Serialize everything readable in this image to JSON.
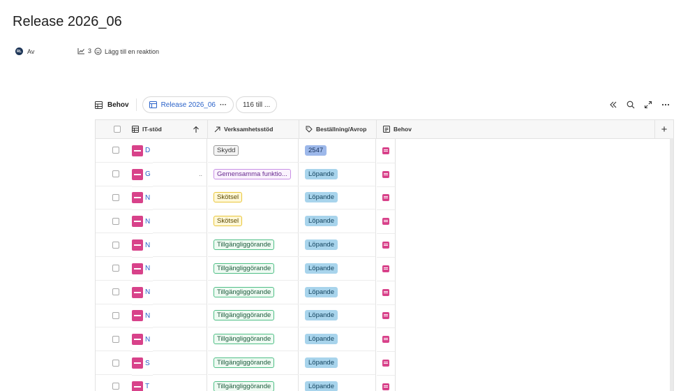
{
  "page": {
    "title": "Release 2026_06",
    "avatar_initials": "RL",
    "author_label": "Av",
    "views_count": "3",
    "reaction_label": "Lägg till en reaktion"
  },
  "toolbar": {
    "db_name": "Behov",
    "view_name": "Release 2026_06",
    "view_more": "···",
    "filter_label": "116 till ...",
    "right_icons": [
      "collapse-icon",
      "search-icon",
      "expand-icon",
      "more-icon"
    ]
  },
  "columns": {
    "it_stod": "IT-stöd",
    "verksamhetsstod": "Verksamhetsstöd",
    "bestallning": "Beställning/Avrop",
    "behov": "Behov",
    "add": "+"
  },
  "rows": [
    {
      "it": "D",
      "verk": "Skydd",
      "verk_color": "gray",
      "best": "2547",
      "best_color": "bluenum",
      "trunc": ""
    },
    {
      "it": "G",
      "verk": "Gemensamma funktio...",
      "verk_color": "purple",
      "best": "Löpande",
      "best_color": "blue",
      "trunc": ".."
    },
    {
      "it": "N",
      "verk": "Skötsel",
      "verk_color": "yellow",
      "best": "Löpande",
      "best_color": "blue",
      "trunc": ""
    },
    {
      "it": "N",
      "verk": "Skötsel",
      "verk_color": "yellow",
      "best": "Löpande",
      "best_color": "blue",
      "trunc": ""
    },
    {
      "it": "N",
      "verk": "Tillgängliggörande",
      "verk_color": "green",
      "best": "Löpande",
      "best_color": "blue",
      "trunc": ""
    },
    {
      "it": "N",
      "verk": "Tillgängliggörande",
      "verk_color": "green",
      "best": "Löpande",
      "best_color": "blue",
      "trunc": ""
    },
    {
      "it": "N",
      "verk": "Tillgängliggörande",
      "verk_color": "green",
      "best": "Löpande",
      "best_color": "blue",
      "trunc": ""
    },
    {
      "it": "N",
      "verk": "Tillgängliggörande",
      "verk_color": "green",
      "best": "Löpande",
      "best_color": "blue",
      "trunc": ""
    },
    {
      "it": "N",
      "verk": "Tillgängliggörande",
      "verk_color": "green",
      "best": "Löpande",
      "best_color": "blue",
      "trunc": ""
    },
    {
      "it": "S",
      "verk": "Tillgängliggörande",
      "verk_color": "green",
      "best": "Löpande",
      "best_color": "blue",
      "trunc": ""
    },
    {
      "it": "T",
      "verk": "Tillgängliggörande",
      "verk_color": "green",
      "best": "Löpande",
      "best_color": "blue",
      "trunc": ""
    }
  ],
  "colors": {
    "it_icon": "#d8428a",
    "link_blue": "#2a62c9"
  }
}
